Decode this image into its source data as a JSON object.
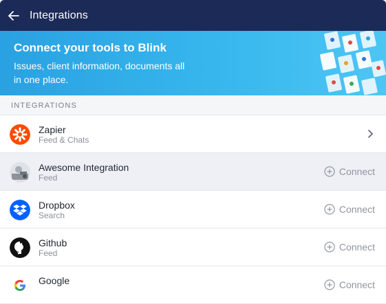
{
  "header": {
    "title": "Integrations"
  },
  "banner": {
    "title": "Connect your tools to Blink",
    "subtitle": "Issues, client information, documents all in one place."
  },
  "section": {
    "label": "INTEGRATIONS"
  },
  "integrations": [
    {
      "name": "Zapier",
      "desc": "Feed & Chats",
      "action": ""
    },
    {
      "name": "Awesome Integration",
      "desc": "Feed",
      "action": "Connect"
    },
    {
      "name": "Dropbox",
      "desc": "Search",
      "action": "Connect"
    },
    {
      "name": "Github",
      "desc": "Feed",
      "action": "Connect"
    },
    {
      "name": "Google",
      "desc": "",
      "action": "Connect"
    }
  ],
  "colors": {
    "header_bg": "#1c2a57",
    "banner_bg": "#2aa1e2",
    "zapier": "#ff4a00",
    "dropbox": "#0061fe",
    "github": "#111111"
  }
}
